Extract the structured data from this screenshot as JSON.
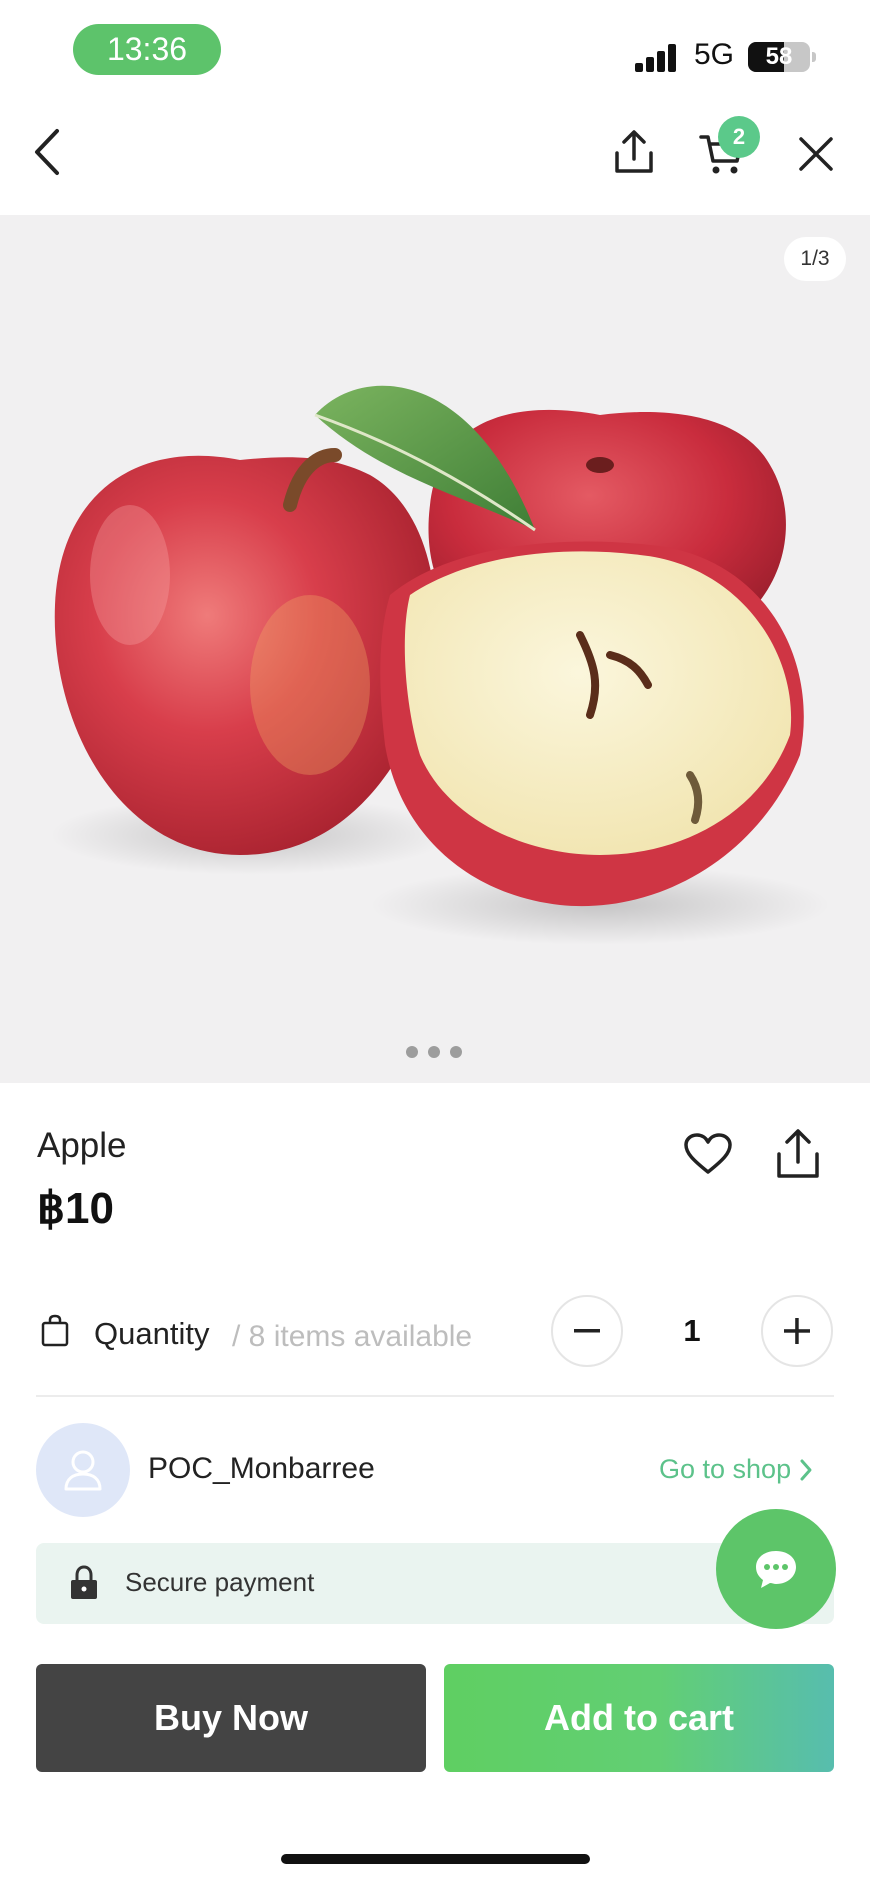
{
  "status_bar": {
    "time": "13:36",
    "network": "5G",
    "battery": "58",
    "battery_level_percent": 58
  },
  "header": {
    "cart_count": "2",
    "icons": [
      "back-arrow-icon",
      "share-icon",
      "cart-icon",
      "close-icon"
    ]
  },
  "gallery": {
    "counter": "1/3",
    "page_count": 3
  },
  "product": {
    "name": "Apple",
    "price": "฿10"
  },
  "quantity": {
    "label": "Quantity",
    "available": "/ 8 items available",
    "value": "1"
  },
  "shop": {
    "name": "POC_Monbarree",
    "go_to_shop": "Go to shop"
  },
  "secure": {
    "label": "Secure payment"
  },
  "actions": {
    "buy_now": "Buy Now",
    "add_to_cart": "Add to cart"
  },
  "colors": {
    "accent_green": "#5dc569",
    "badge_green": "#5bc98a",
    "buy_button": "#444444",
    "secure_bg": "#eaf4f0",
    "link_green": "#5cc28a"
  }
}
